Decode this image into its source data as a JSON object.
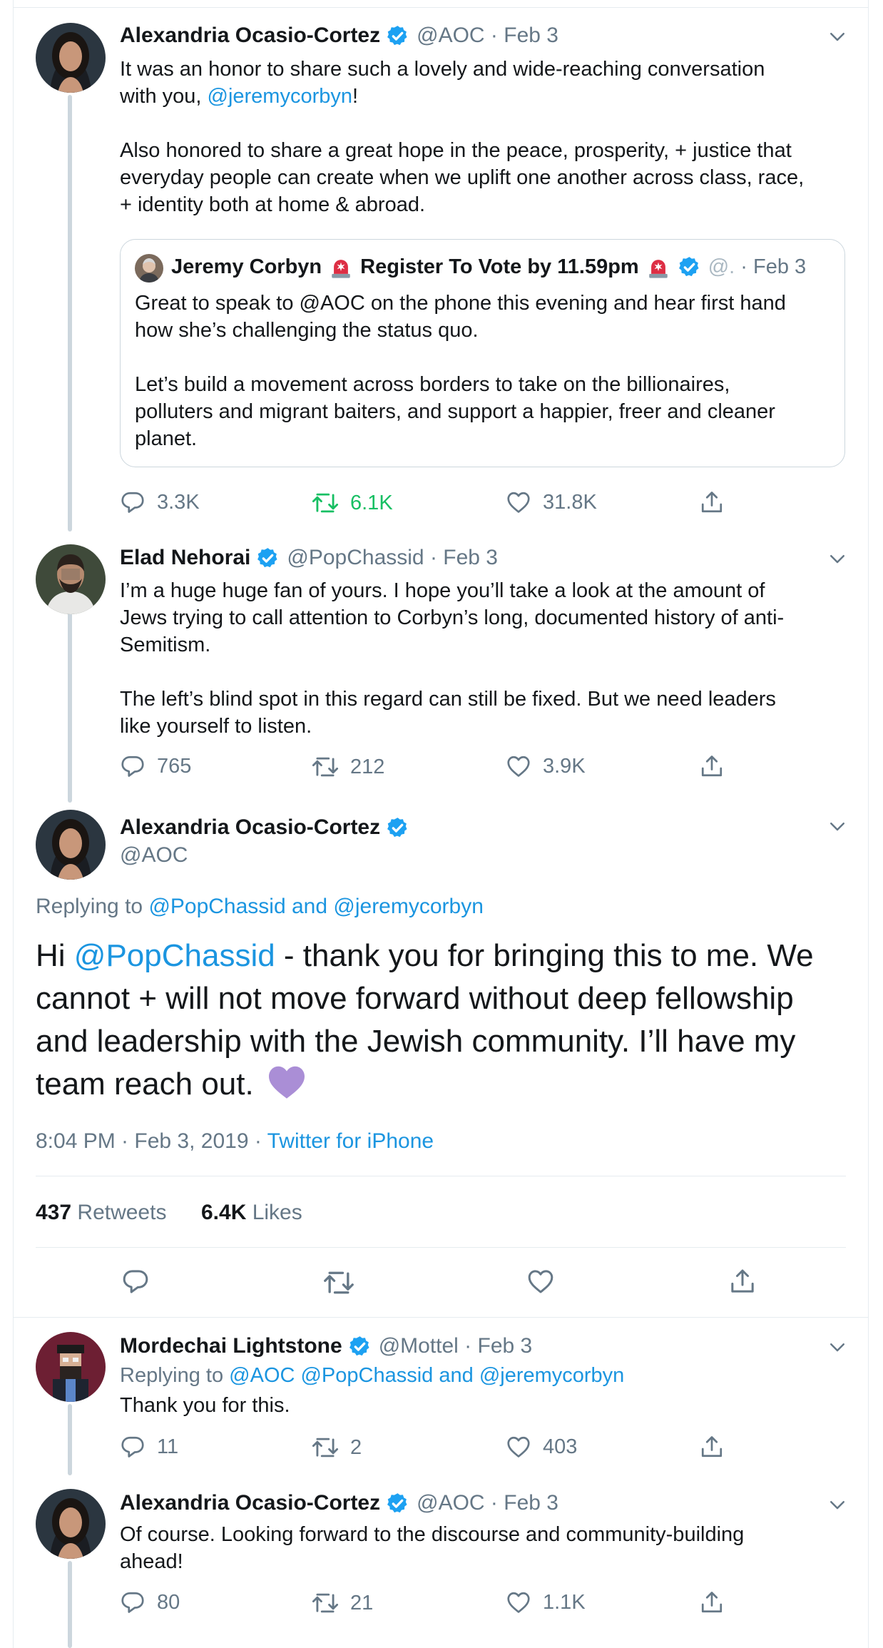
{
  "tweet1": {
    "name": "Alexandria Ocasio-Cortez",
    "handle": "@AOC",
    "date": "Feb 3",
    "text_line1": "It was an honor to share such a lovely and wide-reaching conversation",
    "text_line2_pre": "with you, ",
    "text_line2_link": "@jeremycorbyn",
    "text_line2_post": "!",
    "para2_line1": "Also honored to share a great hope in the peace, prosperity, + justice that",
    "para2_line2": "everyday people can create when we uplift one another across class, race,",
    "para2_line3": "+ identity both at home & abroad.",
    "quote": {
      "name": "Jeremy Corbyn",
      "name_suffix": "Register To Vote by 11.59pm",
      "handle": "@.",
      "date": "Feb 3",
      "line1": "Great to speak to @AOC on the phone this evening and hear first hand",
      "line2": "how she’s challenging the status quo.",
      "line3": "Let’s build a movement across borders to take on the billionaires,",
      "line4": "polluters and migrant baiters, and support a happier, freer and cleaner",
      "line5": "planet."
    },
    "replies": "3.3K",
    "retweets": "6.1K",
    "likes": "31.8K"
  },
  "tweet2": {
    "name": "Elad Nehorai",
    "handle": "@PopChassid",
    "date": "Feb 3",
    "line1": "I’m a huge huge fan of yours. I hope you’ll take a look at the amount of",
    "line2": "Jews trying to call attention to Corbyn’s long, documented history of anti-",
    "line3": "Semitism.",
    "line4": "The left’s blind spot in this regard can still be fixed. But we need leaders",
    "line5": "like yourself to listen.",
    "replies": "765",
    "retweets": "212",
    "likes": "3.9K"
  },
  "main": {
    "name": "Alexandria Ocasio-Cortez",
    "handle": "@AOC",
    "replying_prefix": "Replying to ",
    "replying_user1": "@PopChassid",
    "replying_and": " and ",
    "replying_user2": "@jeremycorbyn",
    "text_link": "@PopChassid",
    "text_line1_post": " - thank you for bringing this to me. We",
    "text_pre": "Hi ",
    "text_line2": "cannot + will not move forward without deep fellowship",
    "text_line3": "and leadership with the Jewish community. I’ll have my",
    "text_line4": "team reach out.",
    "timestamp": "8:04 PM · Feb 3, 2019 · ",
    "source": "Twitter for iPhone",
    "retweets_count": "437",
    "retweets_label": " Retweets",
    "likes_count": "6.4K",
    "likes_label": " Likes"
  },
  "tweet3": {
    "name": "Mordechai Lightstone",
    "handle": "@Mottel",
    "date": "Feb 3",
    "replying_prefix": "Replying to ",
    "replying_users": "@AOC @PopChassid",
    "replying_and": " and ",
    "replying_user3": "@jeremycorbyn",
    "text": "Thank you for this.",
    "replies": "11",
    "retweets": "2",
    "likes": "403"
  },
  "tweet4": {
    "name": "Alexandria Ocasio-Cortez",
    "handle": "@AOC",
    "date": "Feb 3",
    "line1": "Of course. Looking forward to the discourse and community-building",
    "line2": "ahead!",
    "replies": "80",
    "retweets": "21",
    "likes": "1.1K"
  },
  "colors": {
    "link": "#1b95e0",
    "verified": "#1da1f2",
    "retweet_active": "#17bf63",
    "muted": "#657786",
    "heart_emoji": "#aa8ed6"
  },
  "icons": [
    "verified-badge-icon",
    "chevron-down-icon",
    "reply-icon",
    "retweet-icon",
    "like-icon",
    "share-icon",
    "siren-emoji-icon",
    "purple-heart-emoji-icon"
  ]
}
